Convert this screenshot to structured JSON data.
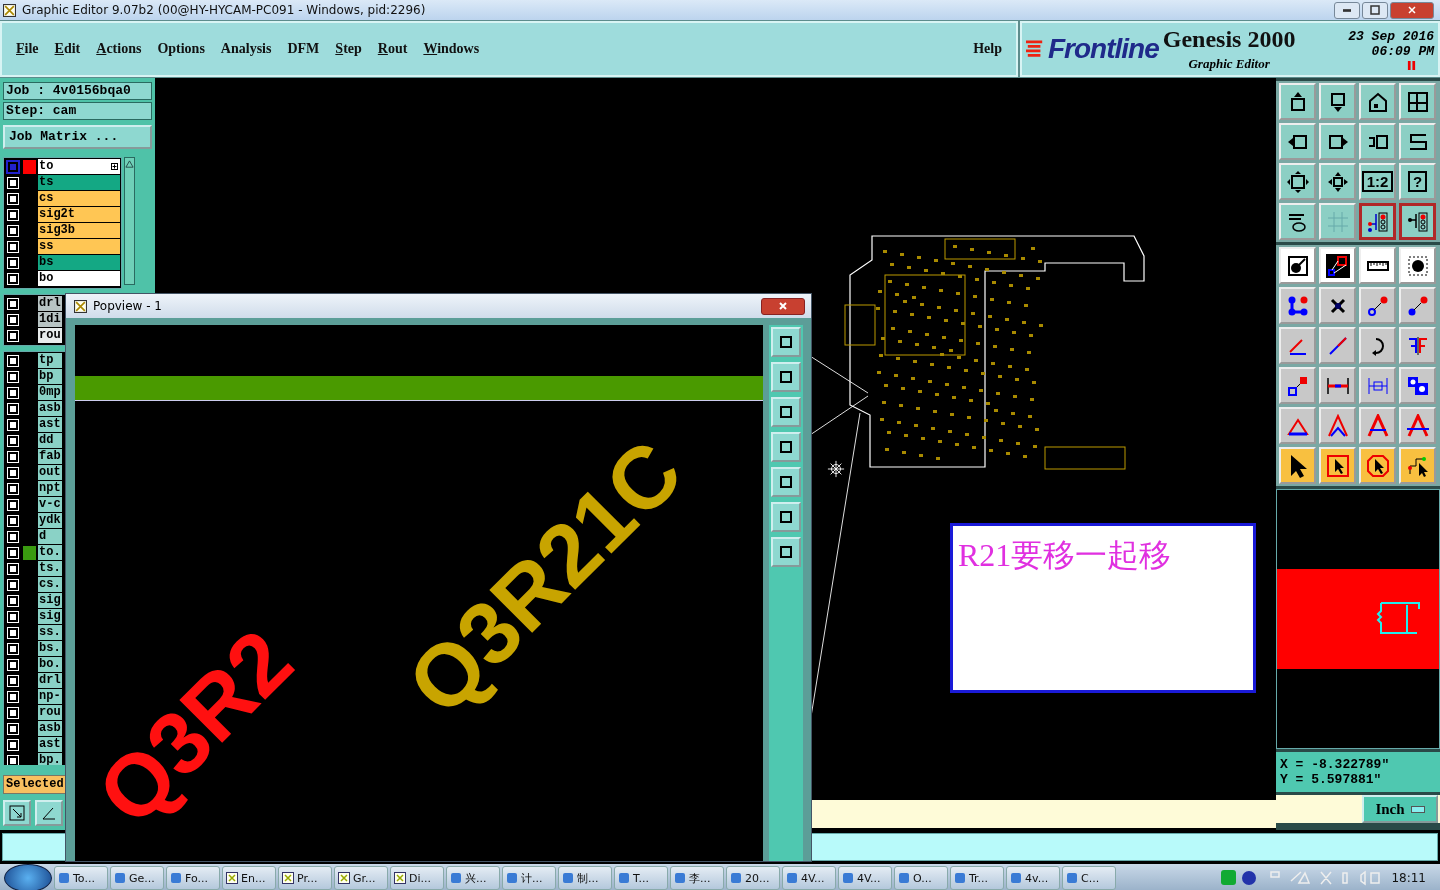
{
  "window": {
    "title": "Graphic Editor 9.07b2 (00@HY-HYCAM-PC091 - Windows, pid:2296)"
  },
  "menu": [
    {
      "label": "File",
      "mnemonic": true
    },
    {
      "label": "Edit",
      "mnemonic": true
    },
    {
      "label": "Actions",
      "mnemonic": true
    },
    {
      "label": "Options",
      "mnemonic": false
    },
    {
      "label": "Analysis",
      "mnemonic": false
    },
    {
      "label": "DFM",
      "mnemonic": false
    },
    {
      "label": "Step",
      "mnemonic": true
    },
    {
      "label": "Rout",
      "mnemonic": true
    },
    {
      "label": "Windows",
      "mnemonic": true
    }
  ],
  "help": "Help",
  "logo": {
    "brand": "Frontline",
    "product": "Genesis 2000",
    "subtitle": "Graphic Editor",
    "date": "23 Sep 2016",
    "time": "06:09 PM"
  },
  "job": {
    "job": "Job : 4v0156bqa0",
    "step": "Step: cam",
    "matrix_button": "Job Matrix ..."
  },
  "layer_groups": [
    [
      {
        "name": "to",
        "kind": "silk",
        "work": true,
        "color": "#ff0000"
      },
      {
        "name": "ts",
        "kind": "mask",
        "work": false
      },
      {
        "name": "cs",
        "kind": "signal",
        "work": false
      },
      {
        "name": "sig2t",
        "kind": "signal",
        "work": false
      },
      {
        "name": "sig3b",
        "kind": "signal",
        "work": false
      },
      {
        "name": "ss",
        "kind": "signal",
        "work": false
      },
      {
        "name": "bs",
        "kind": "mask",
        "work": false
      },
      {
        "name": "bo",
        "kind": "silk",
        "work": false
      }
    ],
    [
      {
        "name": "drl",
        "kind": "drill",
        "work": false
      },
      {
        "name": "1di",
        "kind": "drill",
        "work": false
      },
      {
        "name": "rou",
        "kind": "rout",
        "work": false
      }
    ],
    [
      {
        "name": "tp",
        "kind": "doc",
        "work": false
      },
      {
        "name": "bp",
        "kind": "doc",
        "work": false
      },
      {
        "name": "0mp",
        "kind": "doc",
        "work": false
      },
      {
        "name": "asb",
        "kind": "doc",
        "work": false
      },
      {
        "name": "ast",
        "kind": "doc",
        "work": false
      },
      {
        "name": "dd",
        "kind": "doc",
        "work": false
      },
      {
        "name": "fab",
        "kind": "doc",
        "work": false
      },
      {
        "name": "out",
        "kind": "doc",
        "work": false
      },
      {
        "name": "npt",
        "kind": "doc",
        "work": false
      },
      {
        "name": "v-c",
        "kind": "doc",
        "work": false
      },
      {
        "name": "ydk",
        "kind": "doc",
        "work": false
      },
      {
        "name": "d",
        "kind": "doc",
        "work": false
      },
      {
        "name": "to.",
        "kind": "doc",
        "work": false,
        "color": "#3a9a10"
      },
      {
        "name": "ts.",
        "kind": "doc",
        "work": false
      },
      {
        "name": "cs.",
        "kind": "doc",
        "work": false
      },
      {
        "name": "sig",
        "kind": "doc",
        "work": false
      },
      {
        "name": "sig",
        "kind": "doc",
        "work": false
      },
      {
        "name": "ss.",
        "kind": "doc",
        "work": false
      },
      {
        "name": "bs.",
        "kind": "doc",
        "work": false
      },
      {
        "name": "bo.",
        "kind": "doc",
        "work": false
      },
      {
        "name": "drl",
        "kind": "doc",
        "work": false
      },
      {
        "name": "np-",
        "kind": "doc",
        "work": false
      },
      {
        "name": "rou",
        "kind": "doc",
        "work": false
      },
      {
        "name": "asb",
        "kind": "doc",
        "work": false
      },
      {
        "name": "ast",
        "kind": "doc",
        "work": false
      },
      {
        "name": "bp.",
        "kind": "doc",
        "work": false
      }
    ]
  ],
  "selected_label": "Selected",
  "tool_groups": [
    [
      {
        "kind": "view",
        "active": false
      },
      {
        "kind": "view",
        "active": false
      },
      {
        "kind": "view",
        "active": false
      },
      {
        "kind": "view",
        "active": false
      },
      {
        "kind": "view",
        "active": false
      },
      {
        "kind": "view",
        "active": false
      },
      {
        "kind": "view",
        "active": false
      },
      {
        "kind": "view",
        "active": false
      },
      {
        "kind": "view",
        "active": false
      },
      {
        "kind": "view",
        "active": false
      },
      {
        "kind": "view",
        "active": false,
        "label": "1:2"
      },
      {
        "kind": "view",
        "active": false,
        "label": "?"
      },
      {
        "kind": "view",
        "active": false
      },
      {
        "kind": "view",
        "active": false
      },
      {
        "kind": "view",
        "active": true
      },
      {
        "kind": "view",
        "active": true
      }
    ],
    [
      {
        "kind": "measure",
        "active": false
      },
      {
        "kind": "measure",
        "active": false
      },
      {
        "kind": "measure",
        "active": false
      },
      {
        "kind": "measure",
        "active": false
      },
      {
        "kind": "edit",
        "active": false
      },
      {
        "kind": "edit",
        "active": false
      },
      {
        "kind": "edit",
        "active": false
      },
      {
        "kind": "edit",
        "active": false
      },
      {
        "kind": "edit",
        "active": false
      },
      {
        "kind": "edit",
        "active": false
      },
      {
        "kind": "edit",
        "active": false
      },
      {
        "kind": "edit",
        "active": false
      },
      {
        "kind": "edit",
        "active": false
      },
      {
        "kind": "edit",
        "active": false
      },
      {
        "kind": "edit",
        "active": false
      },
      {
        "kind": "edit",
        "active": false
      },
      {
        "kind": "edit",
        "active": false
      },
      {
        "kind": "edit",
        "active": false
      },
      {
        "kind": "edit",
        "active": false
      },
      {
        "kind": "edit",
        "active": false
      },
      {
        "kind": "select",
        "active": false
      },
      {
        "kind": "select",
        "active": false
      },
      {
        "kind": "select",
        "active": false
      },
      {
        "kind": "select",
        "active": false
      }
    ]
  ],
  "canvas": {
    "note": "R21要移一起移"
  },
  "popview": {
    "title": "Popview - 1",
    "silkscreen": [
      {
        "text": "Q3R21C",
        "color": "#c8a400"
      },
      {
        "text": "Q3R2",
        "color": "#ff1010"
      }
    ]
  },
  "coords": {
    "x": "X = -8.322789\"",
    "y": "Y = 5.597881\""
  },
  "units": "Inch",
  "taskbar": {
    "items": [
      {
        "label": "To...",
        "kind": "app"
      },
      {
        "label": "Ge...",
        "kind": "app"
      },
      {
        "label": "Fo...",
        "kind": "app"
      },
      {
        "label": "En...",
        "kind": "genesis"
      },
      {
        "label": "Pr...",
        "kind": "genesis"
      },
      {
        "label": "Gr...",
        "kind": "genesis"
      },
      {
        "label": "Di...",
        "kind": "genesis"
      },
      {
        "label": "兴...",
        "kind": "app"
      },
      {
        "label": "计...",
        "kind": "app"
      },
      {
        "label": "制...",
        "kind": "app"
      },
      {
        "label": "T...",
        "kind": "app"
      },
      {
        "label": "李...",
        "kind": "app"
      },
      {
        "label": "20...",
        "kind": "app"
      },
      {
        "label": "4V...",
        "kind": "app"
      },
      {
        "label": "4V...",
        "kind": "app"
      },
      {
        "label": "O...",
        "kind": "app"
      },
      {
        "label": "Tr...",
        "kind": "app"
      },
      {
        "label": "4v...",
        "kind": "app"
      },
      {
        "label": "C...",
        "kind": "app"
      }
    ],
    "clock": "18:11"
  }
}
